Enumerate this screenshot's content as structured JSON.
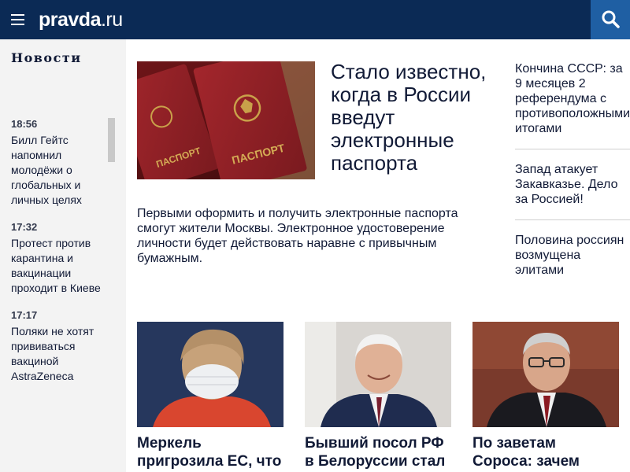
{
  "header": {
    "logo_main": "pravda",
    "logo_tld": ".ru"
  },
  "sidebar": {
    "title": "Новости",
    "items": [
      {
        "time": "18:56",
        "text": "Билл Гейтс напомнил молодёжи о глобальных и личных целях"
      },
      {
        "time": "17:32",
        "text": "Протест против карантина и вакцинации проходит в Киеве"
      },
      {
        "time": "17:17",
        "text": "Поляки не хотят прививаться вакциной AstraZeneca"
      }
    ]
  },
  "lead": {
    "image_text": "ПАСПОРТ",
    "title": "Стало известно, когда в России введут электронные паспорта",
    "summary": "Первыми оформить и получить электронные паспорта смогут жители Москвы. Электронное удостоверение личности будет действовать наравне с привычным бумажным."
  },
  "right_column": [
    "Кончина СССР: за 9 месяцев 2 референдума с противоположными итогами",
    "Запад атакует Закавказье. Дело за Россией!",
    "Половина россиян возмущена элитами"
  ],
  "cards": [
    {
      "title": "Меркель пригрозила ЕС, что ФРГ"
    },
    {
      "title": "Бывший посол РФ в Белоруссии стал"
    },
    {
      "title": "По заветам Сороса: зачем"
    }
  ],
  "colors": {
    "header_bg": "#0b2a55",
    "search_bg": "#1f5fa3",
    "sidebar_bg": "#f3f3f3",
    "text": "#111a36"
  }
}
